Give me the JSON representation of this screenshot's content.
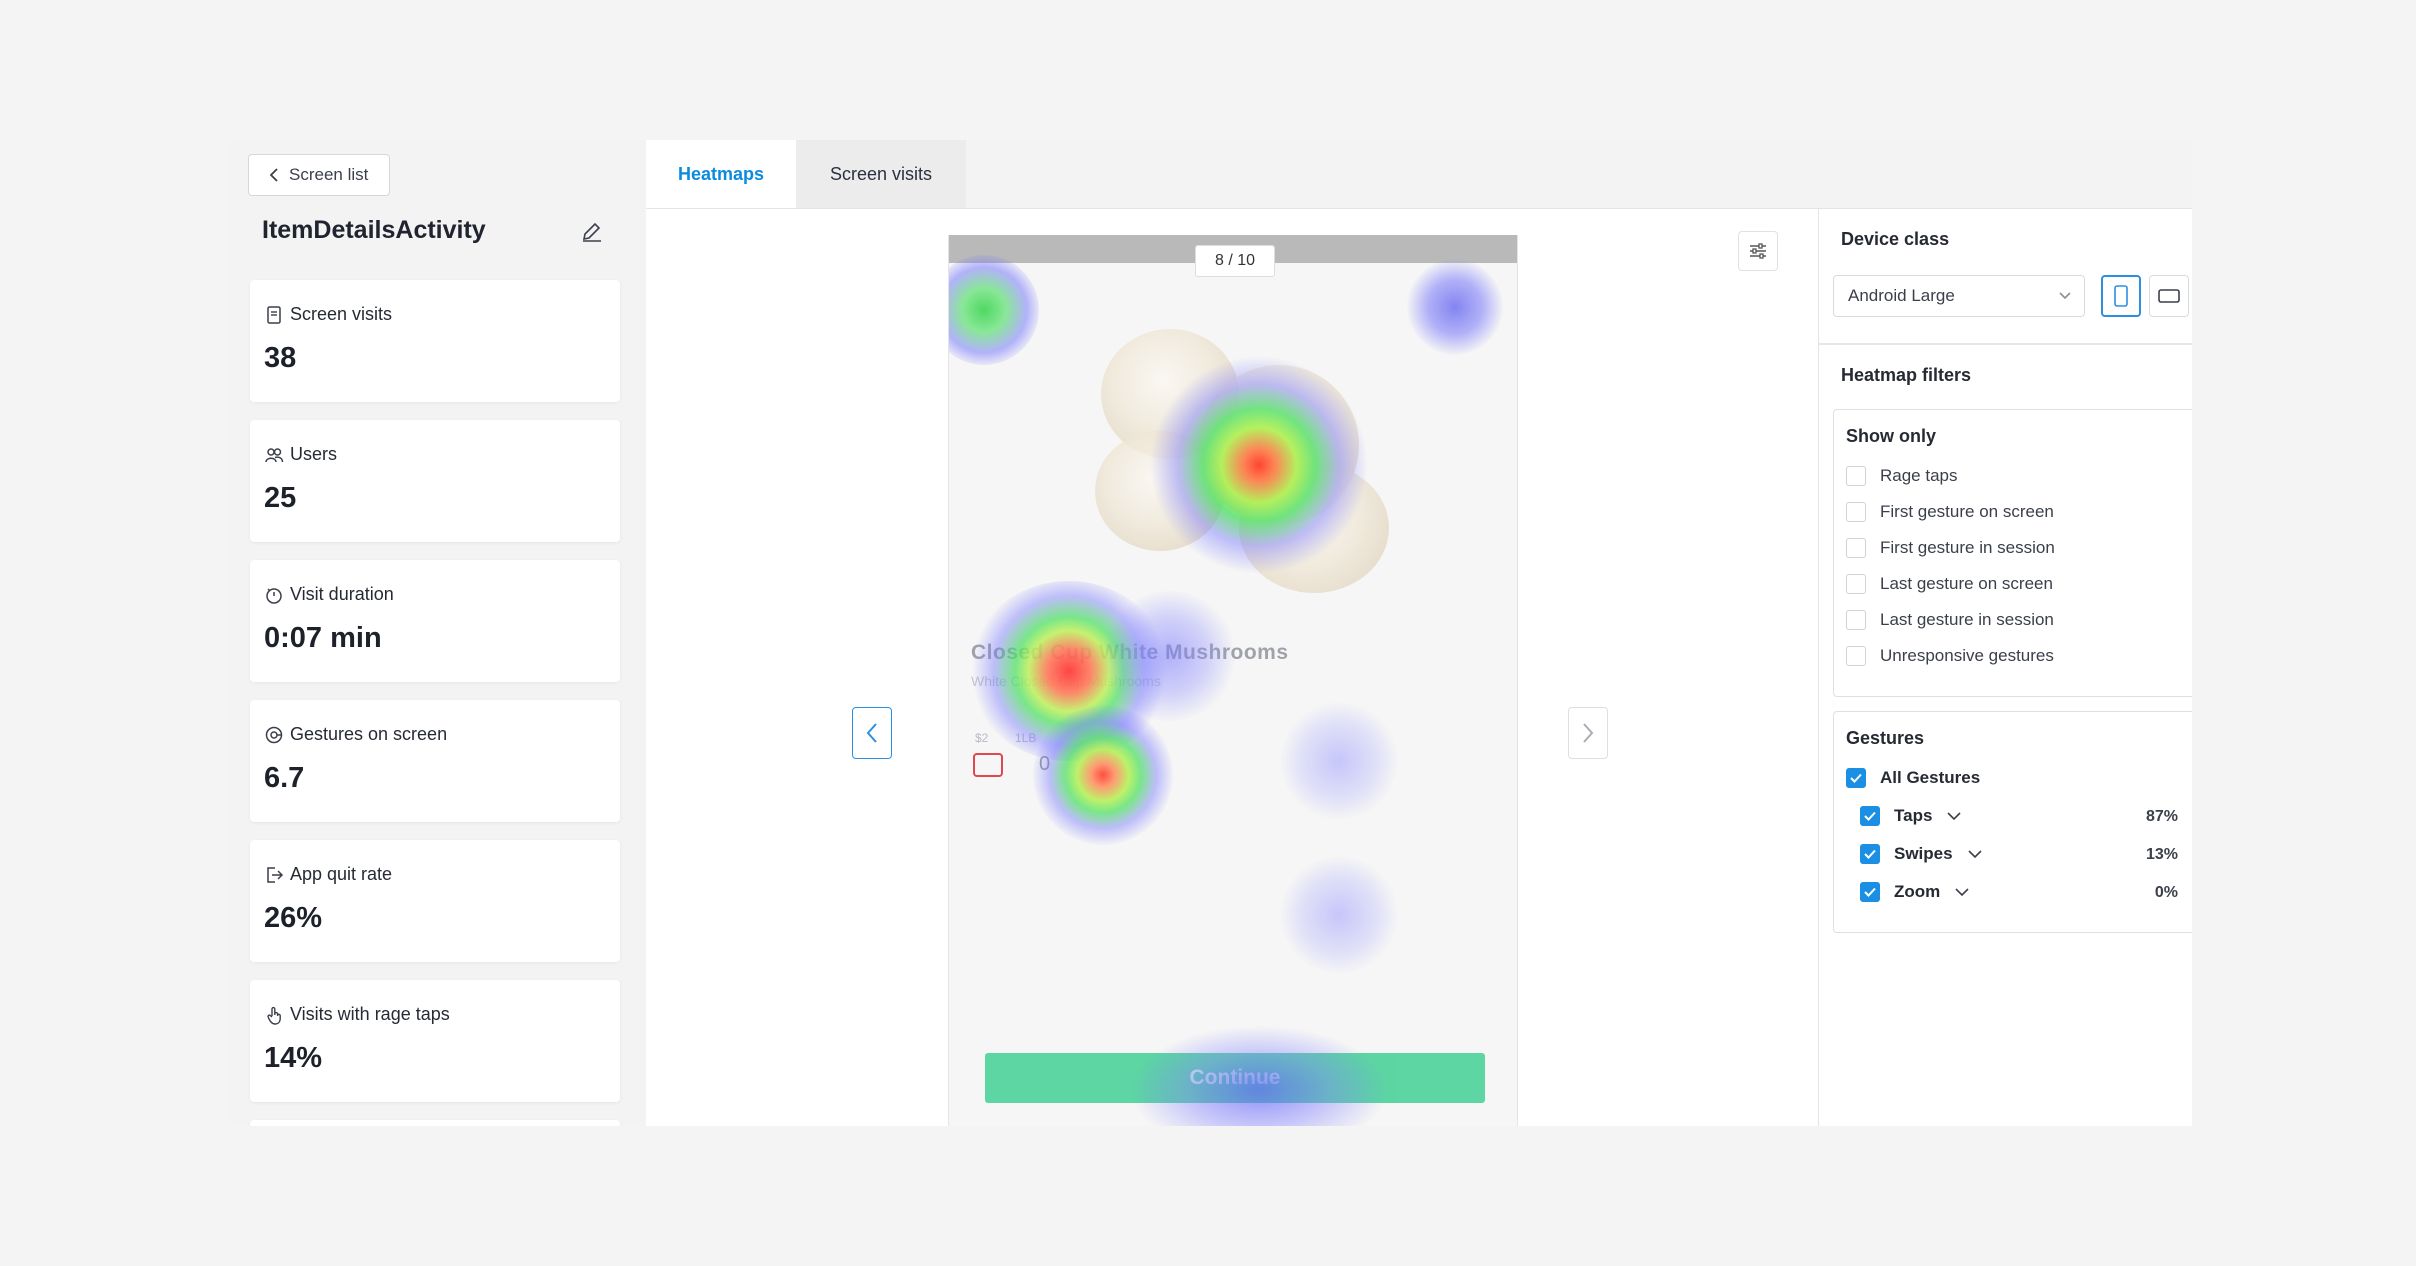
{
  "sidebar": {
    "back_label": "Screen list",
    "screen_name": "ItemDetailsActivity",
    "metrics": [
      {
        "label": "Screen visits",
        "value": "38"
      },
      {
        "label": "Users",
        "value": "25"
      },
      {
        "label": "Visit duration",
        "value": "0:07 min"
      },
      {
        "label": "Gestures on screen",
        "value": "6.7"
      },
      {
        "label": "App quit rate",
        "value": "26%"
      },
      {
        "label": "Visits with rage taps",
        "value": "14%"
      }
    ]
  },
  "tabs": [
    {
      "label": "Heatmaps",
      "active": true
    },
    {
      "label": "Screen visits",
      "active": false
    }
  ],
  "preview": {
    "page_indicator": "8 / 10",
    "product_title": "Closed Cup White Mushrooms",
    "product_subtitle": "White Closed Cup Mushrooms",
    "price_label": "$2",
    "weight_label": "1LB",
    "quantity": "0",
    "continue_label": "Continue"
  },
  "device_class": {
    "heading": "Device class",
    "selected": "Android Large"
  },
  "heatmap_filters": {
    "heading": "Heatmap filters",
    "show_only": {
      "title": "Show only",
      "options": [
        {
          "label": "Rage taps",
          "checked": false
        },
        {
          "label": "First gesture on screen",
          "checked": false
        },
        {
          "label": "First gesture in session",
          "checked": false
        },
        {
          "label": "Last gesture on screen",
          "checked": false
        },
        {
          "label": "Last gesture in session",
          "checked": false
        },
        {
          "label": "Unresponsive gestures",
          "checked": false
        }
      ]
    },
    "gestures": {
      "title": "Gestures",
      "all_label": "All Gestures",
      "items": [
        {
          "label": "Taps",
          "percent": "87%"
        },
        {
          "label": "Swipes",
          "percent": "13%"
        },
        {
          "label": "Zoom",
          "percent": "0%"
        }
      ]
    }
  },
  "colors": {
    "accent": "#1a8fe3",
    "active_tab": "#0a8be0",
    "continue_button": "#4fd39b",
    "rage_red": "#e04850"
  }
}
